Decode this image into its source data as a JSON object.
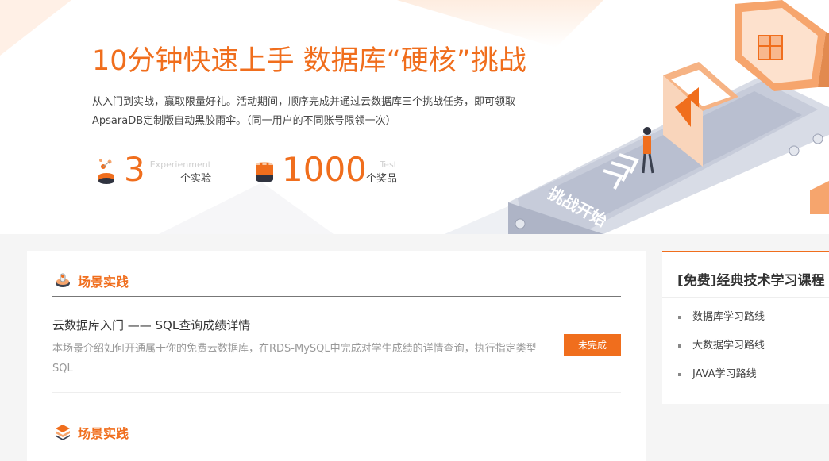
{
  "hero": {
    "title": "10分钟快速上手 数据库“硬核”挑战",
    "description": "从入门到实战，赢取限量好礼。活动期间，顺序完成并通过云数据库三个挑战任务，即可领取ApsaraDB定制版自动黑胶雨伞。（同一用户的不同账号限领一次）",
    "stats": [
      {
        "value": "3",
        "label_en": "Experienment",
        "label_cn": "个实验",
        "icon": "experiment-icon"
      },
      {
        "value": "1000",
        "label_en": "Test",
        "label_cn": "个奖品",
        "icon": "cake-prize-icon"
      }
    ],
    "illustration_text": "挑战开始",
    "accent_color": "#f06e1d"
  },
  "sections": [
    {
      "title": "场景实践",
      "icon": "lab-flask-icon",
      "item": {
        "title": "云数据库入门 —— SQL查询成绩详情",
        "description": "本场景介绍如何开通属于你的免费云数据库，在RDS-MySQL中完成对学生成绩的详情查询，执行指定类型SQL",
        "status": "未完成"
      }
    },
    {
      "title": "场景实践",
      "icon": "layers-stack-icon"
    }
  ],
  "sidebar": {
    "title": "[免费]经典技术学习课程",
    "links": [
      "数据库学习路线",
      "大数据学习路线",
      "JAVA学习路线"
    ]
  }
}
